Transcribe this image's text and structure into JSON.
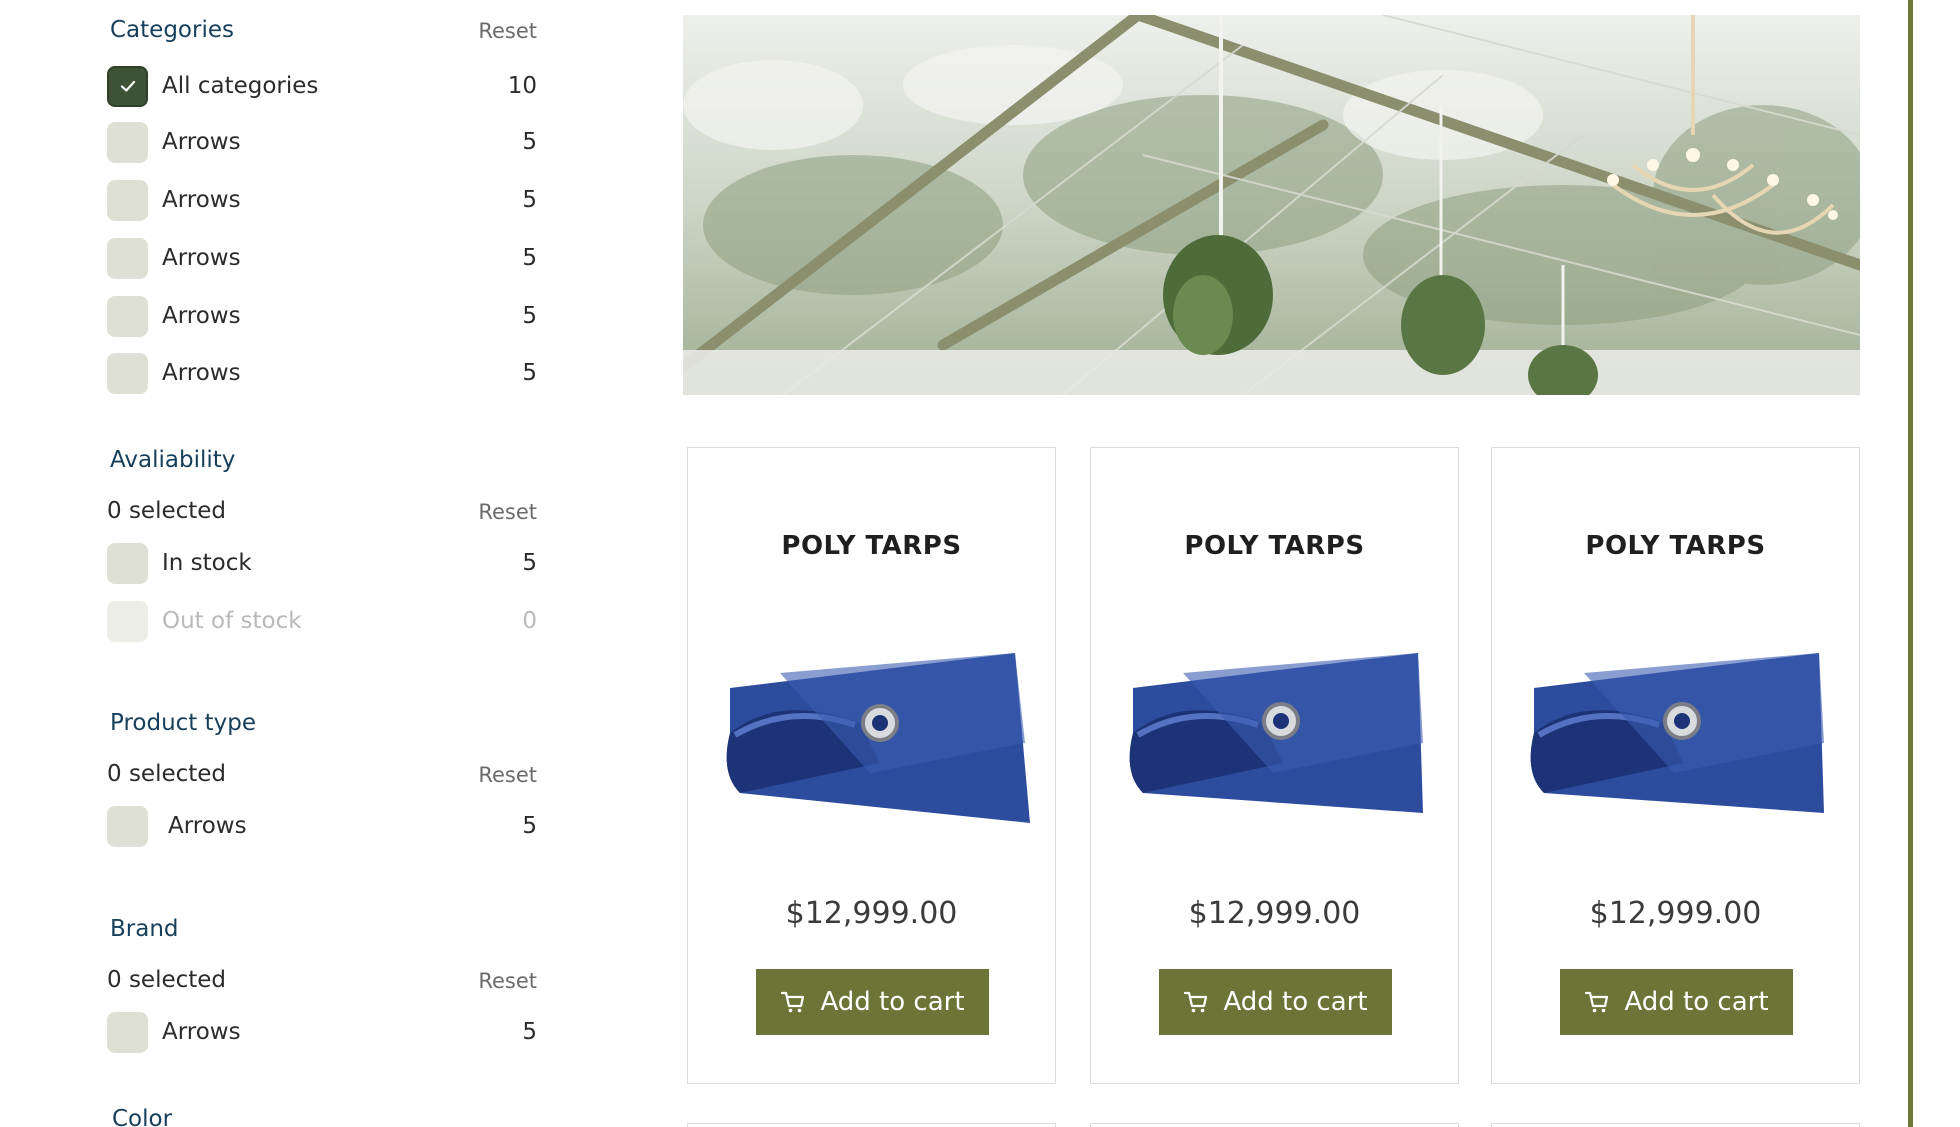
{
  "filters": {
    "categories": {
      "title": "Categories",
      "reset_label": "Reset",
      "items": [
        {
          "label": "All categories",
          "count": "10",
          "checked": true
        },
        {
          "label": "Arrows",
          "count": "5"
        },
        {
          "label": "Arrows",
          "count": "5"
        },
        {
          "label": "Arrows",
          "count": "5"
        },
        {
          "label": "Arrows",
          "count": "5"
        },
        {
          "label": "Arrows",
          "count": "5"
        }
      ]
    },
    "availability": {
      "title": "Avaliability",
      "selected_text": "0 selected",
      "reset_label": "Reset",
      "items": [
        {
          "label": "In stock",
          "count": "5"
        },
        {
          "label": "Out of stock",
          "count": "0",
          "disabled": true
        }
      ]
    },
    "product_type": {
      "title": "Product type",
      "selected_text": "0 selected",
      "reset_label": "Reset",
      "items": [
        {
          "label": "Arrows",
          "count": "5"
        }
      ]
    },
    "brand": {
      "title": "Brand",
      "selected_text": "0 selected",
      "reset_label": "Reset",
      "items": [
        {
          "label": "Arrows",
          "count": "5"
        }
      ]
    },
    "color": {
      "title": "Color"
    }
  },
  "products": [
    {
      "title": "POLY TARPS",
      "price": "$12,999.00",
      "button_label": "Add to cart"
    },
    {
      "title": "POLY TARPS",
      "price": "$12,999.00",
      "button_label": "Add to cart"
    },
    {
      "title": "POLY TARPS",
      "price": "$12,999.00",
      "button_label": "Add to cart"
    }
  ],
  "icons": {
    "checkbox": "check-icon",
    "cart": "cart-icon"
  },
  "colors": {
    "accent": "#6c7537",
    "heading": "#163f5c",
    "checkbox_checked": "#3e5236",
    "checkbox": "#dfe0d5"
  }
}
